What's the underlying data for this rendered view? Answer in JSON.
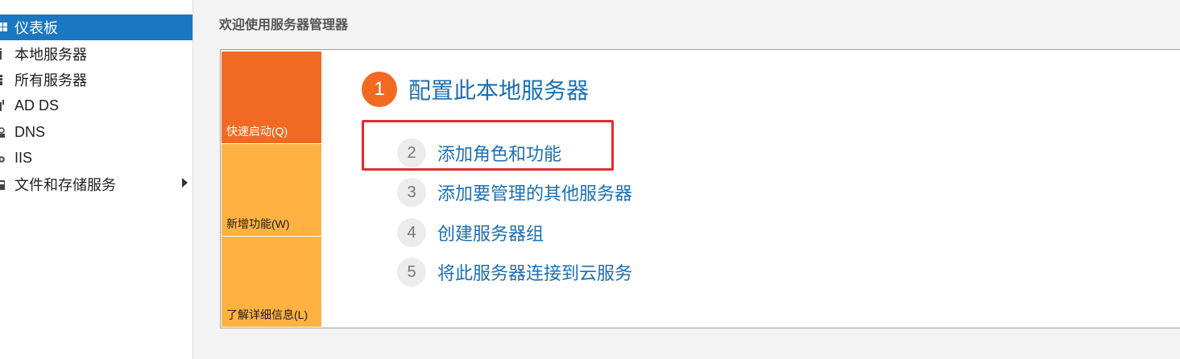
{
  "sidebar": {
    "items": [
      {
        "label": "仪表板",
        "icon": "dashboard-icon",
        "active": true
      },
      {
        "label": "本地服务器",
        "icon": "local-server-icon"
      },
      {
        "label": "所有服务器",
        "icon": "all-servers-icon"
      },
      {
        "label": "AD DS",
        "icon": "ad-ds-icon"
      },
      {
        "label": "DNS",
        "icon": "dns-icon"
      },
      {
        "label": "IIS",
        "icon": "iis-icon"
      },
      {
        "label": "文件和存储服务",
        "icon": "file-storage-icon",
        "has_submenu": true
      }
    ]
  },
  "main": {
    "title": "欢迎使用服务器管理器",
    "tiles": [
      {
        "label": "快速启动(Q)"
      },
      {
        "label": "新增功能(W)"
      },
      {
        "label": "了解详细信息(L)"
      }
    ],
    "steps": [
      {
        "number": "1",
        "label": "配置此本地服务器"
      },
      {
        "number": "2",
        "label": "添加角色和功能"
      },
      {
        "number": "3",
        "label": "添加要管理的其他服务器"
      },
      {
        "number": "4",
        "label": "创建服务器组"
      },
      {
        "number": "5",
        "label": "将此服务器连接到云服务"
      }
    ]
  },
  "colors": {
    "active_nav": "#1a78c2",
    "tile_primary": "#f26a22",
    "tile_secondary": "#ffb242",
    "link_blue": "#1b6fb3",
    "highlight_red": "#e02c35"
  }
}
